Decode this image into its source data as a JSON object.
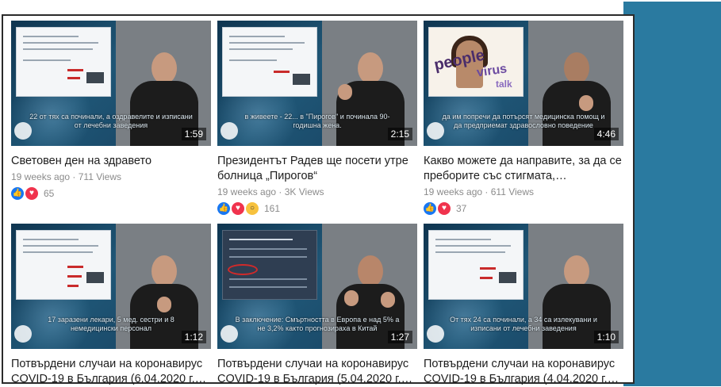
{
  "videos": [
    {
      "title": "Световен ден на здравето",
      "age": "19 weeks ago",
      "views": "711 Views",
      "duration": "1:59",
      "subtitle": "22 от тях са починали, а оздравелите и изписани от лечебни заведения",
      "reactions": [
        "like",
        "love"
      ],
      "reaction_count": "65"
    },
    {
      "title": "Президентът Радев ще посети утре болница „Пирогов“",
      "age": "19 weeks ago",
      "views": "3K Views",
      "duration": "2:15",
      "subtitle": "в живеете - 22... в \"Пирогов\" и починала 90-годишна жена.",
      "reactions": [
        "like",
        "love",
        "wow"
      ],
      "reaction_count": "161"
    },
    {
      "title": "Какво можете да направите, за да се преборите със стигмата,…",
      "age": "19 weeks ago",
      "views": "611 Views",
      "duration": "4:46",
      "subtitle": "да им попречи да потърсят медицинска помощ и да предприемат здравословно поведение",
      "reactions": [
        "like",
        "love"
      ],
      "reaction_count": "37"
    },
    {
      "title": "Потвърдени случаи на коронавирус COVID-19 в България (6.04.2020 г.…",
      "age": "",
      "views": "",
      "duration": "1:12",
      "subtitle": "17 заразени лекари, 5 мед. сестри и 8 немедицински персонал",
      "reactions": [],
      "reaction_count": ""
    },
    {
      "title": "Потвърдени случаи на коронавирус COVID-19 в България (5.04.2020 г.…",
      "age": "",
      "views": "",
      "duration": "1:27",
      "subtitle": "В заключение: Смъртността в Европа е над 5% а не 3,2% както прогнозираха в Китай",
      "reactions": [],
      "reaction_count": ""
    },
    {
      "title": "Потвърдени случаи на коронавирус COVID-19 в България (4.04.2020 г.…",
      "age": "",
      "views": "",
      "duration": "1:10",
      "subtitle": "От тях 24 са починали, а 34 са излекувани и изписани от лечебни заведения",
      "reactions": [],
      "reaction_count": ""
    }
  ],
  "meta_separator": " · ",
  "colors": {
    "side_panel": "#2a7aa0",
    "like": "#1877f2",
    "love": "#f0334d",
    "wow": "#f7c23e"
  },
  "icons": {
    "like": "thumbs-up-icon",
    "love": "heart-icon",
    "wow": "wow-face-icon"
  }
}
